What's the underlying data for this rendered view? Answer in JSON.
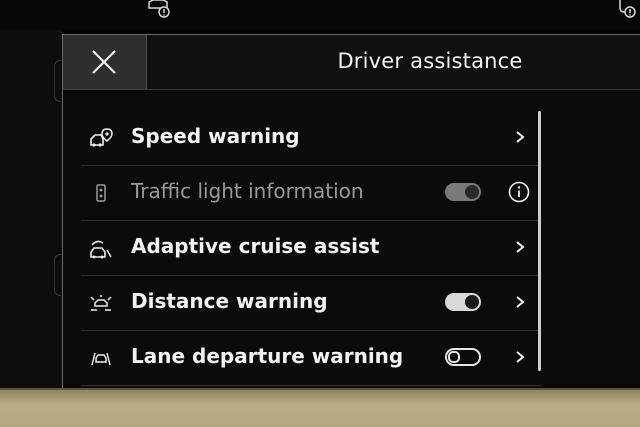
{
  "header": {
    "title": "Driver assistance"
  },
  "items": [
    {
      "label": "Speed warning",
      "icon": "speed-warning-icon",
      "control": "chevron",
      "enabled": true
    },
    {
      "label": "Traffic light information",
      "icon": "traffic-light-icon",
      "control": "toggle+info",
      "toggle": "on-dimmed",
      "enabled": false
    },
    {
      "label": "Adaptive cruise assist",
      "icon": "cruise-assist-icon",
      "control": "chevron",
      "enabled": true
    },
    {
      "label": "Distance warning",
      "icon": "distance-warning-icon",
      "control": "toggle+chevron",
      "toggle": "on",
      "enabled": true
    },
    {
      "label": "Lane departure warning",
      "icon": "lane-departure-icon",
      "control": "toggle+chevron",
      "toggle": "off",
      "enabled": true
    }
  ],
  "colors": {
    "background": "#050505",
    "panel": "#0b0b0b",
    "close_button": "#2e2e2e",
    "text": "#f2f2f2",
    "text_disabled": "#9a9a9a",
    "bezel": "#b3a883"
  }
}
